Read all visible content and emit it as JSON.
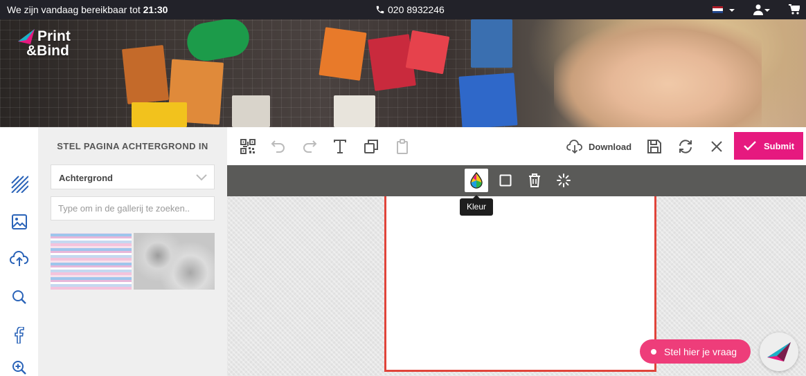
{
  "topbar": {
    "hours_prefix": "We zijn vandaag bereikbaar tot",
    "hours_time": "21:30",
    "phone": "020 8932246",
    "flag_colors": [
      "#ae1c28",
      "#ffffff",
      "#21468b"
    ]
  },
  "logo": {
    "line1": "Print",
    "line2": "&Bind"
  },
  "rail": {
    "items": [
      {
        "icon": "background-pattern-icon",
        "active": true
      },
      {
        "icon": "image-icon"
      },
      {
        "icon": "upload-icon"
      },
      {
        "icon": "search-icon"
      },
      {
        "icon": "facebook-icon"
      },
      {
        "icon": "zoom-in-icon"
      }
    ]
  },
  "panel": {
    "title": "STEL PAGINA ACHTERGROND IN",
    "select_value": "Achtergrond",
    "search_placeholder": "Type om in de gallerij te zoeken.."
  },
  "toolbar": {
    "tools": [
      "qr-code-icon",
      "undo-icon",
      "redo-icon",
      "text-icon",
      "layers-icon",
      "clipboard-icon"
    ],
    "download_label": "Download",
    "submit_label": "Submit",
    "submit_color": "#e6197f"
  },
  "context_bar": {
    "tools": [
      "color-icon",
      "square-icon",
      "trash-icon",
      "loader-icon"
    ],
    "tooltip": "Kleur"
  },
  "chat": {
    "label": "Stel hier je vraag",
    "color": "#ee3d7a"
  }
}
